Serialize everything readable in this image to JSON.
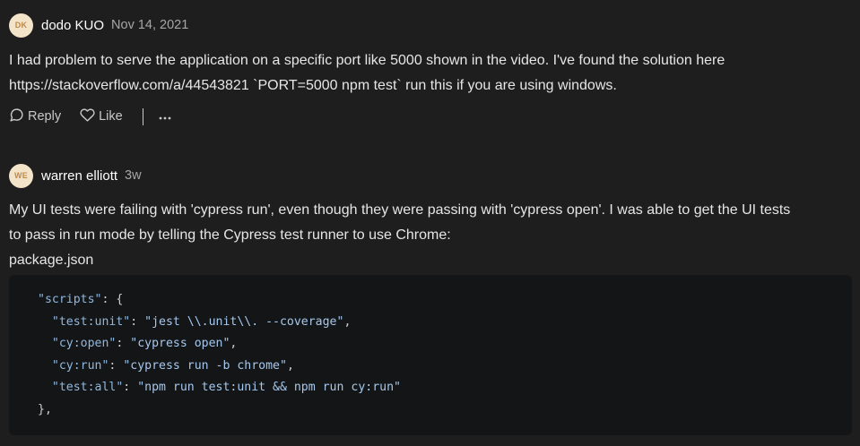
{
  "comments": [
    {
      "avatar_initials": "DK",
      "author": "dodo KUO",
      "time": "Nov 14, 2021",
      "body_lines": [
        "I had problem to serve the application on a specific port like 5000 shown in the video. I've found the solution here",
        "https://stackoverflow.com/a/44543821 `PORT=5000 npm test` run this if you are using windows."
      ],
      "actions": {
        "reply": "Reply",
        "like": "Like",
        "more": "more"
      }
    },
    {
      "avatar_initials": "WE",
      "author": "warren elliott",
      "time": "3w",
      "body_lines": [
        "My UI tests were failing with 'cypress run', even though they were passing with 'cypress open'. I was able to get the UI tests",
        "to pass in run mode by telling the Cypress test runner to use Chrome:",
        "package.json"
      ],
      "code": {
        "open_key": "\"scripts\"",
        "open_rest": ": {",
        "entries": [
          {
            "key": "\"test:unit\"",
            "value": "\"jest \\\\.unit\\\\. --coverage\"",
            "trail": ","
          },
          {
            "key": "\"cy:open\"",
            "value": "\"cypress open\"",
            "trail": ","
          },
          {
            "key": "\"cy:run\"",
            "value": "\"cypress run -b chrome\"",
            "trail": ","
          },
          {
            "key": "\"test:all\"",
            "value": "\"npm run test:unit && npm run cy:run\"",
            "trail": ""
          }
        ],
        "close": "},"
      }
    }
  ],
  "colors": {
    "background": "#1e1e1f",
    "code_bg": "#141517",
    "avatar_bg": "#f3e3c8",
    "code_key": "#8fb8e0"
  },
  "icons": {
    "reply": "speech-bubble-icon",
    "like": "heart-icon",
    "more": "ellipsis-icon"
  }
}
